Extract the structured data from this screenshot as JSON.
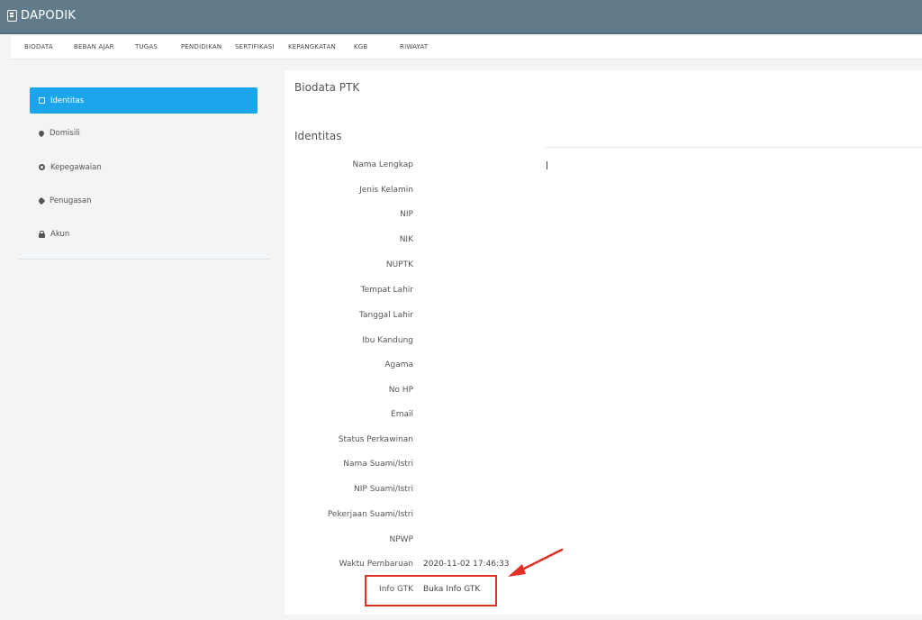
{
  "app": {
    "title": "DAPODIK"
  },
  "tabs": [
    {
      "label": "BIODATA"
    },
    {
      "label": "BEBAN AJAR"
    },
    {
      "label": "TUGAS"
    },
    {
      "label": "PENDIDIKAN"
    },
    {
      "label": "SERTIFIKASI"
    },
    {
      "label": "KEPANGKATAN"
    },
    {
      "label": "KGB"
    },
    {
      "label": "RIWAYAT"
    }
  ],
  "sidebar": {
    "items": [
      {
        "label": "Identitas",
        "icon": "id-card-icon",
        "active": true
      },
      {
        "label": "Domisili",
        "icon": "map-pin-icon"
      },
      {
        "label": "Kepegawaian",
        "icon": "gear-icon"
      },
      {
        "label": "Penugasan",
        "icon": "tag-icon"
      },
      {
        "label": "Akun",
        "icon": "lock-icon"
      }
    ]
  },
  "main": {
    "title": "Biodata PTK",
    "section": "Identitas",
    "fields": [
      {
        "label": "Nama Lengkap",
        "value": ""
      },
      {
        "label": "Jenis Kelamin",
        "value": ""
      },
      {
        "label": "NIP",
        "value": ""
      },
      {
        "label": "NIK",
        "value": ""
      },
      {
        "label": "NUPTK",
        "value": ""
      },
      {
        "label": "Tempat Lahir",
        "value": ""
      },
      {
        "label": "Tanggal Lahir",
        "value": ""
      },
      {
        "label": "Ibu Kandung",
        "value": ""
      },
      {
        "label": "Agama",
        "value": ""
      },
      {
        "label": "No HP",
        "value": ""
      },
      {
        "label": "Email",
        "value": ""
      },
      {
        "label": "Status Perkawinan",
        "value": ""
      },
      {
        "label": "Nama Suami/Istri",
        "value": ""
      },
      {
        "label": "NIP Suami/Istri",
        "value": ""
      },
      {
        "label": "Pekerjaan Suami/Istri",
        "value": ""
      },
      {
        "label": "NPWP",
        "value": ""
      },
      {
        "label": "Waktu Pembaruan",
        "value": "2020-11-02 17:46:33"
      },
      {
        "label": "Info GTK",
        "value": "Buka Info GTK"
      }
    ]
  },
  "colors": {
    "header": "#617b8a",
    "accent": "#1ba5ea",
    "annotation": "#e03127"
  }
}
